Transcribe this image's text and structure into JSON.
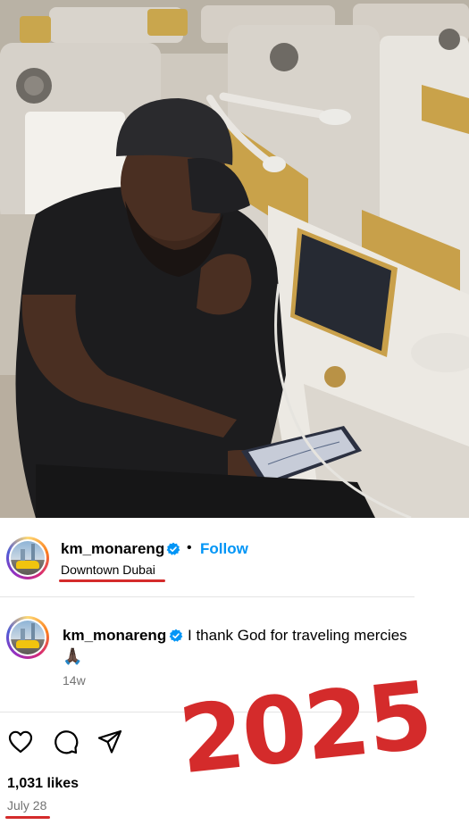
{
  "post": {
    "username": "km_monareng",
    "follow_label": "Follow",
    "separator": "•",
    "location": "Downtown Dubai"
  },
  "caption": {
    "username": "km_monareng",
    "text": "I thank God for traveling mercies",
    "emoji": "🙏🏿",
    "time_ago": "14w"
  },
  "actions": {
    "like_icon": "heart-icon",
    "comment_icon": "comment-icon",
    "share_icon": "share-icon"
  },
  "likes_text": "1,031 likes",
  "date_text": "July 28",
  "annotation": {
    "year": "2025",
    "color": "#d42b2b"
  },
  "colors": {
    "follow": "#0095f6",
    "muted": "#737373",
    "verified": "#0095f6"
  }
}
